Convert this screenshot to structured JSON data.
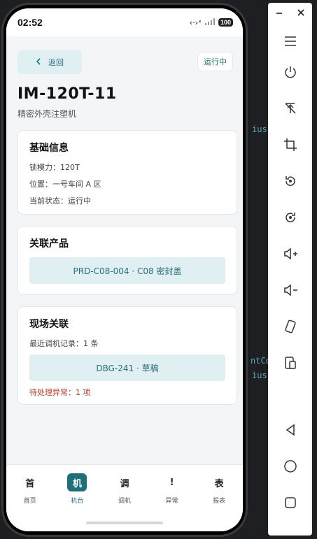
{
  "status_bar": {
    "time": "02:52",
    "sys_icons": "‹·›ˣ",
    "battery": "100"
  },
  "header": {
    "back_label": "返回",
    "status_badge": "运行中"
  },
  "machine": {
    "title": "IM-120T-11",
    "subtitle": "精密外壳注塑机"
  },
  "basic_info": {
    "heading": "基础信息",
    "rows": [
      "锁模力：120T",
      "位置：一号车间 A 区",
      "当前状态：运行中"
    ]
  },
  "related_product": {
    "heading": "关联产品",
    "link": "PRD-C08-004 · C08 密封盖"
  },
  "field": {
    "heading": "现场关联",
    "recent_debug": "最近调机记录：1 条",
    "debug_link": "DBG-241 · 草稿",
    "pending": "待处理异常：1 项"
  },
  "tabs": [
    {
      "glyph": "首",
      "label": "首页",
      "active": false
    },
    {
      "glyph": "机",
      "label": "机台",
      "active": true
    },
    {
      "glyph": "调",
      "label": "调机",
      "active": false
    },
    {
      "glyph": "!",
      "label": "异常",
      "active": false
    },
    {
      "glyph": "表",
      "label": "报表",
      "active": false
    }
  ],
  "ide_fragments": [
    "ius",
    "ntCo",
    "ius"
  ],
  "emulator_toolbar": {
    "top_icons": [
      "minimize-icon",
      "close-icon"
    ],
    "buttons": [
      "menu-icon",
      "power-icon",
      "pin-off-icon",
      "crop-icon",
      "rotate-left-icon",
      "rotate-right-icon",
      "volume-up-icon",
      "volume-down-icon",
      "shake-icon",
      "screen-icon",
      "back-icon",
      "home-icon",
      "overview-icon"
    ]
  },
  "colors": {
    "accent": "#1f6f7a",
    "link_bg": "#dfeff2",
    "warn": "#b23b2e"
  }
}
